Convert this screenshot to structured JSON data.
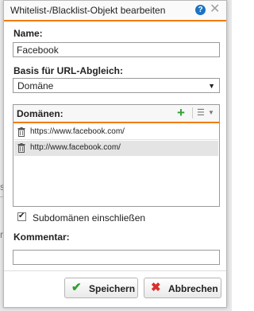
{
  "dialog": {
    "title": "Whitelist-/Blacklist-Objekt bearbeiten",
    "help_icon": "question-mark-icon",
    "close_icon": "close-icon"
  },
  "name": {
    "label": "Name:",
    "value": "Facebook"
  },
  "url_basis": {
    "label": "Basis für URL-Abgleich:",
    "selected": "Domäne"
  },
  "domains": {
    "label": "Domänen:",
    "add_icon": "plus-icon",
    "menu_icon": "list-icon",
    "items": [
      {
        "text": "https://www.facebook.com/",
        "icon": "trash-icon"
      },
      {
        "text": "http://www.facebook.com/",
        "icon": "trash-icon"
      }
    ]
  },
  "subdomains": {
    "label": "Subdomänen einschließen",
    "checked": true
  },
  "comment": {
    "label": "Kommentar:",
    "value": ""
  },
  "buttons": {
    "save_label": "Speichern",
    "cancel_label": "Abbrechen"
  },
  "colors": {
    "accent": "#f07d00",
    "save_check": "#2ea12e",
    "cancel_x": "#d9302c",
    "help": "#1c73c2"
  },
  "background": {
    "mark1": "s",
    "mark2": "r"
  }
}
